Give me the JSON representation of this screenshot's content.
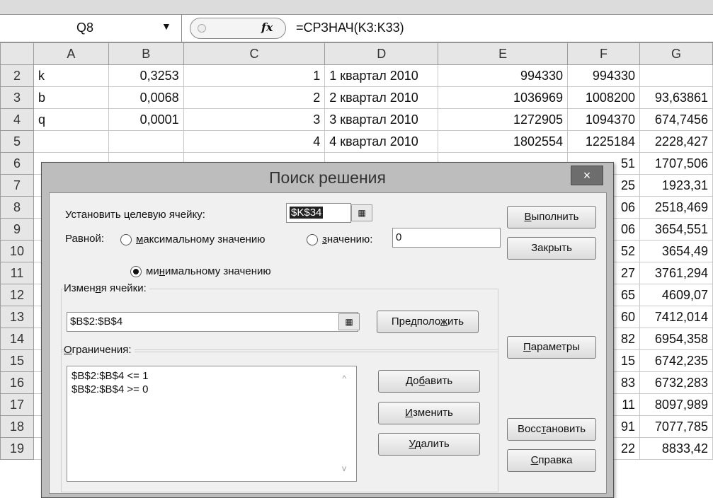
{
  "formula_bar": {
    "cell_ref": "Q8",
    "fx_icon": "fx-icon",
    "formula": "=СРЗНАЧ(K3:K33)"
  },
  "columns": [
    "A",
    "B",
    "C",
    "D",
    "E",
    "F",
    "G"
  ],
  "rows": [
    {
      "n": "2",
      "cells": [
        "k",
        "0,3253",
        "1",
        "1 квартал 2010",
        "994330",
        "994330",
        ""
      ]
    },
    {
      "n": "3",
      "cells": [
        "b",
        "0,0068",
        "2",
        "2 квартал 2010",
        "1036969",
        "1008200",
        "93,63861"
      ]
    },
    {
      "n": "4",
      "cells": [
        "q",
        "0,0001",
        "3",
        "3 квартал 2010",
        "1272905",
        "1094370",
        "674,7456"
      ]
    },
    {
      "n": "5",
      "cells": [
        "",
        "",
        "4",
        "4 квартал 2010",
        "1802554",
        "1225184",
        "2228,427"
      ]
    },
    {
      "n": "6",
      "cells": [
        "",
        "",
        "",
        "",
        "",
        "51",
        "1707,506"
      ]
    },
    {
      "n": "7",
      "cells": [
        "",
        "",
        "",
        "",
        "",
        "25",
        "1923,31"
      ]
    },
    {
      "n": "8",
      "cells": [
        "",
        "",
        "",
        "",
        "",
        "06",
        "2518,469"
      ]
    },
    {
      "n": "9",
      "cells": [
        "",
        "",
        "",
        "",
        "",
        "06",
        "3654,551"
      ]
    },
    {
      "n": "10",
      "cells": [
        "",
        "",
        "",
        "",
        "",
        "52",
        "3654,49"
      ]
    },
    {
      "n": "11",
      "cells": [
        "",
        "",
        "",
        "",
        "",
        "27",
        "3761,294"
      ]
    },
    {
      "n": "12",
      "cells": [
        "",
        "",
        "",
        "",
        "",
        "65",
        "4609,07"
      ]
    },
    {
      "n": "13",
      "cells": [
        "",
        "",
        "",
        "",
        "",
        "60",
        "7412,014"
      ]
    },
    {
      "n": "14",
      "cells": [
        "",
        "",
        "",
        "",
        "",
        "82",
        "6954,358"
      ]
    },
    {
      "n": "15",
      "cells": [
        "",
        "",
        "",
        "",
        "",
        "15",
        "6742,235"
      ]
    },
    {
      "n": "16",
      "cells": [
        "",
        "",
        "",
        "",
        "",
        "83",
        "6732,283"
      ]
    },
    {
      "n": "17",
      "cells": [
        "",
        "",
        "",
        "",
        "",
        "11",
        "8097,989"
      ]
    },
    {
      "n": "18",
      "cells": [
        "",
        "",
        "",
        "",
        "",
        "91",
        "7077,785"
      ]
    },
    {
      "n": "19",
      "cells": [
        "",
        "",
        "",
        "",
        "",
        "22",
        "8833,42"
      ]
    }
  ],
  "dialog": {
    "title": "Поиск решения",
    "close_glyph": "×",
    "target_label": "Установить целевую ячейку:",
    "target_value": "$K$34",
    "equal_label": "Равной:",
    "radio_max": {
      "pre": "",
      "ul": "м",
      "post": "аксимальному значению"
    },
    "radio_value": {
      "pre": "",
      "ul": "з",
      "post": "начению:"
    },
    "value_field": "0",
    "radio_min": {
      "pre": "ми",
      "ul": "н",
      "post": "имальному значению"
    },
    "radio_selected": "min",
    "changing_label": {
      "pre": "Измен",
      "ul": "я",
      "post": "я ячейки:"
    },
    "changing_value": "$B$2:$B$4",
    "guess_btn": {
      "pre": "Предполо",
      "ul": "ж",
      "post": "ить"
    },
    "constraints_label": {
      "pre": "",
      "ul": "О",
      "post": "граничения:"
    },
    "constraints": [
      "$B$2:$B$4 <= 1",
      "$B$2:$B$4 >= 0"
    ],
    "add_btn": {
      "pre": "До",
      "ul": "б",
      "post": "авить"
    },
    "change_btn": {
      "pre": "",
      "ul": "И",
      "post": "зменить"
    },
    "delete_btn": {
      "pre": "",
      "ul": "У",
      "post": "далить"
    },
    "run_btn": {
      "pre": "",
      "ul": "В",
      "post": "ыполнить"
    },
    "close_btn": "Закрыть",
    "params_btn": {
      "pre": "",
      "ul": "П",
      "post": "араметры"
    },
    "restore_btn": {
      "pre": "Восс",
      "ul": "т",
      "post": "ановить"
    },
    "help_btn": {
      "pre": "",
      "ul": "С",
      "post": "правка"
    }
  }
}
